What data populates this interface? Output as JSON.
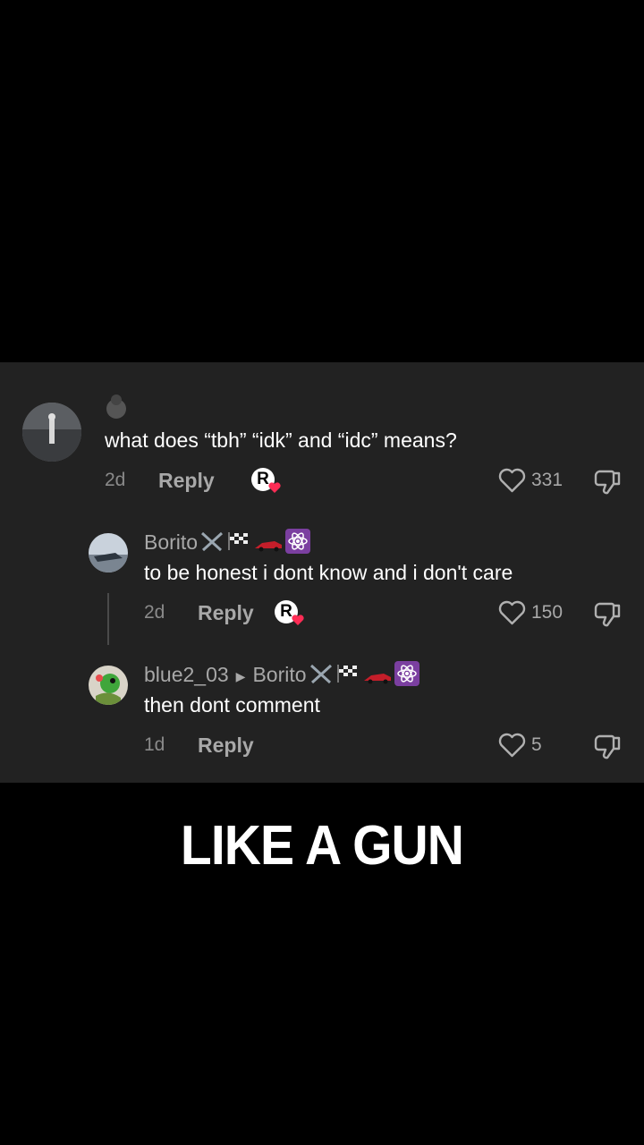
{
  "comments": [
    {
      "username": "",
      "text": "what does “tbh” “idk” and “idc” means?",
      "age": "2d",
      "reply_label": "Reply",
      "creator_badge": "R",
      "likes": "331"
    },
    {
      "username": "Borito",
      "text": "to be honest i dont know and i don't care",
      "age": "2d",
      "reply_label": "Reply",
      "creator_badge": "R",
      "likes": "150"
    },
    {
      "username": "blue2_03",
      "reply_to": "Borito",
      "text": "then dont comment",
      "age": "1d",
      "reply_label": "Reply",
      "likes": "5"
    }
  ],
  "caption": "LIKE A GUN",
  "colors": {
    "panel": "#222222",
    "muted": "#a8a8a8",
    "badge_heart": "#fe2c55"
  }
}
